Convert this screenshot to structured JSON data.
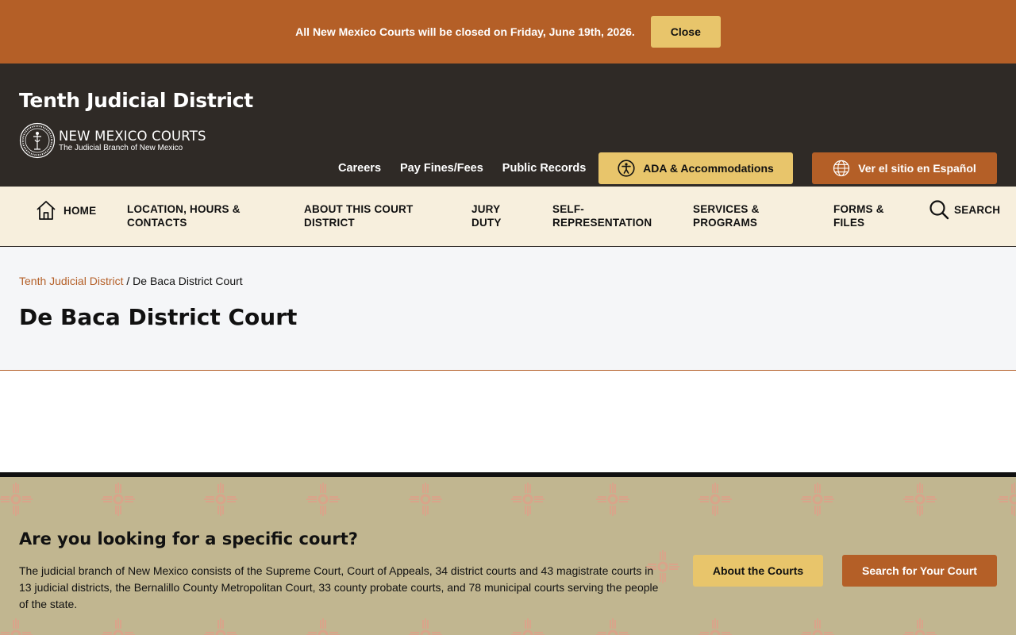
{
  "alert": {
    "message": "All New Mexico Courts will be closed on Friday, June 19th, 2026.",
    "close_label": "Close"
  },
  "header": {
    "site_title": "Tenth Judicial District",
    "logo_title": "NEW MEXICO COURTS",
    "logo_subtitle": "The Judicial Branch of New Mexico",
    "utility_links": [
      "Careers",
      "Pay Fines/Fees",
      "Public Records"
    ],
    "ada_label": "ADA & Accommodations",
    "spanish_label": "Ver el sitio en Español"
  },
  "nav": {
    "home": "HOME",
    "location": "LOCATION, HOURS & CONTACTS",
    "about": "ABOUT THIS COURT DISTRICT",
    "jury": "JURY DUTY",
    "self_rep": "SELF-REPRESENTATION",
    "services": "SERVICES & PROGRAMS",
    "forms": "FORMS & FILES",
    "search": "SEARCH"
  },
  "breadcrumb": {
    "parent": "Tenth Judicial District",
    "separator": " / ",
    "current": "De Baca District Court"
  },
  "page_title": "De Baca District Court",
  "court_finder": {
    "title": "Are you looking for a specific court?",
    "text": "The judicial branch of New Mexico consists of the Supreme Court, Court of Appeals, 34 district courts and 43 magistrate courts in 13 judicial districts, the Bernalillo County Metropolitan Court, 33 county probate courts, and 78 municipal courts serving the people of the state.",
    "about_label": "About the Courts",
    "search_label": "Search for Your Court"
  },
  "colors": {
    "brand_orange": "#b45f27",
    "gold": "#e8c56b",
    "header_dark": "#2f2a26",
    "nav_cream": "#f7efdd",
    "finder_tan": "#c1b690"
  }
}
